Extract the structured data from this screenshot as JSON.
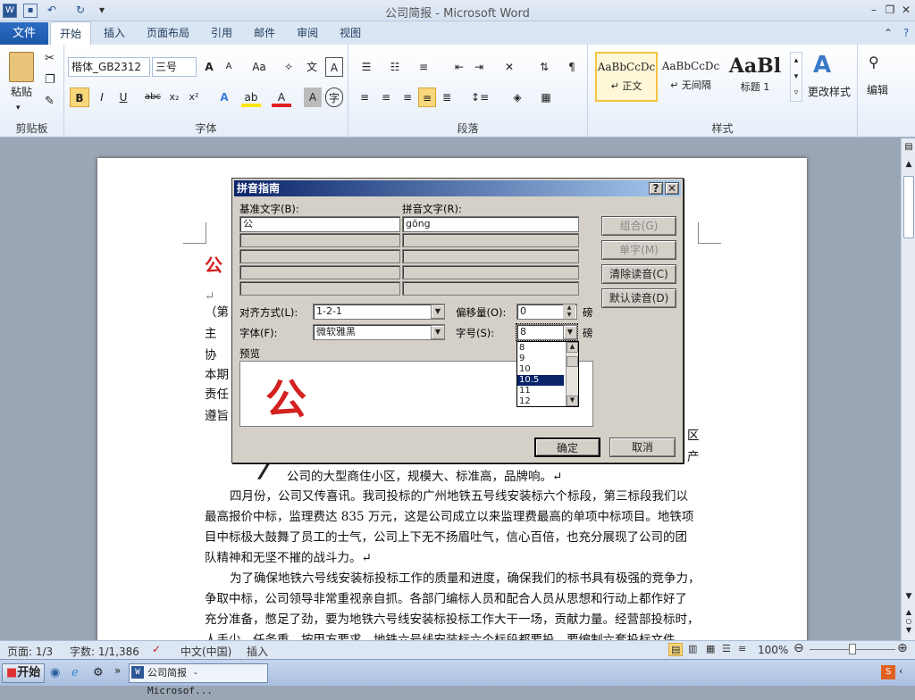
{
  "window": {
    "title": "公司简报 - Microsoft Word",
    "app_icon": "W"
  },
  "ribbon": {
    "tabs": [
      "文件",
      "开始",
      "插入",
      "页面布局",
      "引用",
      "邮件",
      "审阅",
      "视图"
    ],
    "clipboard": {
      "paste": "粘贴",
      "label": "剪贴板"
    },
    "font": {
      "name": "楷体_GB2312",
      "size": "三号",
      "label": "字体"
    },
    "paragraph": {
      "label": "段落"
    },
    "styles": {
      "label": "样式",
      "items": [
        {
          "preview": "AaBbCcDc",
          "name": "↵ 正文"
        },
        {
          "preview": "AaBbCcDc",
          "name": "↵ 无间隔"
        },
        {
          "preview": "AaBl",
          "name": "标题 1"
        }
      ],
      "change": "更改样式"
    },
    "edit": {
      "label": "编辑"
    }
  },
  "document": {
    "heading_char": "公",
    "left_lines": [
      "（第",
      "主",
      "协",
      "本期",
      "责任",
      "遵旨"
    ],
    "right_frag": [
      "区",
      "产"
    ],
    "line_after": "公司的大型商住小区，规模大、标准高，品牌响。↵",
    "paragraphs": [
      "四月份，公司又传喜讯。我司投标的广州地铁五号线安装标六个标段，第三标段我们以",
      "最高报价中标，监理费达 835 万元，这是公司成立以来监理费最高的单项中标项目。地铁项",
      "目中标极大鼓舞了员工的士气，公司上下无不扬眉吐气，信心百倍，也充分展现了公司的团",
      "队精神和无坚不摧的战斗力。↵",
      "为了确保地铁六号线安装标投标工作的质量和进度，确保我们的标书具有极强的竞争力，",
      "争取中标，公司领导非常重视亲自抓。各部门编标人员和配合人员从思想和行动上都作好了",
      "充分准备，憋足了劲，要为地铁六号线安装标投标工作大干一场，贡献力量。经营部投标时，",
      "人手少，任务重，按甲方要求，地铁六号线安装标六个标段都要投，要编制六套投标文件"
    ]
  },
  "dialog": {
    "title": "拼音指南",
    "base_label": "基准文字(B):",
    "ruby_label": "拼音文字(R):",
    "base_text": "公",
    "ruby_text": "gōng",
    "buttons": {
      "group": "组合(G)",
      "single": "单字(M)",
      "clear": "清除读音(C)",
      "default": "默认读音(D)",
      "ok": "确定",
      "cancel": "取消"
    },
    "align_label": "对齐方式(L):",
    "align_value": "1-2-1",
    "offset_label": "偏移量(O):",
    "offset_value": "0",
    "offset_unit": "磅",
    "font_label": "字体(F):",
    "font_value": "微软雅黑",
    "size_label": "字号(S):",
    "size_value": "8",
    "size_unit": "磅",
    "size_options": [
      "8",
      "9",
      "10",
      "10.5",
      "11",
      "12"
    ],
    "size_selected": "10.5",
    "preview_label": "预览",
    "preview_char": "公"
  },
  "status": {
    "page": "页面: 1/3",
    "words": "字数: 1/1,386",
    "lang": "中文(中国)",
    "mode": "插入",
    "zoom": "100%"
  },
  "taskbar": {
    "start": "开始",
    "task": "公司简报 - Microsof..."
  }
}
